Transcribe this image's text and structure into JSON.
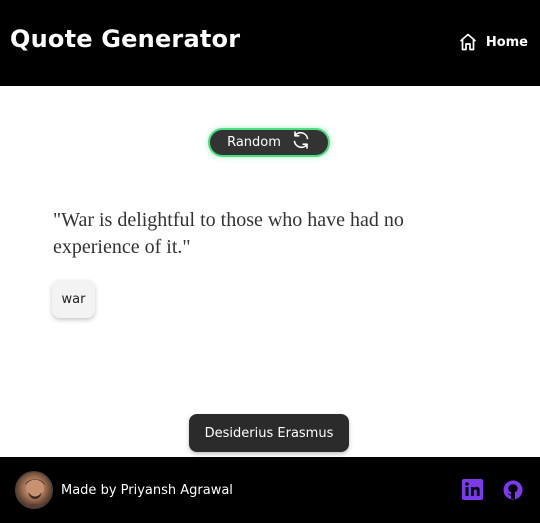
{
  "header": {
    "title": "Quote Generator",
    "home_label": "Home"
  },
  "random_button": {
    "label": "Random",
    "accent": "#4ade80"
  },
  "quote": {
    "text": "\"War is delightful to those who have had no experience of it.\"",
    "tags": [
      "war"
    ],
    "author": "Desiderius Erasmus"
  },
  "footer": {
    "credit": "Made by Priyansh Agrawal",
    "icons": [
      "linkedin-icon",
      "github-icon"
    ],
    "icon_color": "#7c3aed"
  }
}
